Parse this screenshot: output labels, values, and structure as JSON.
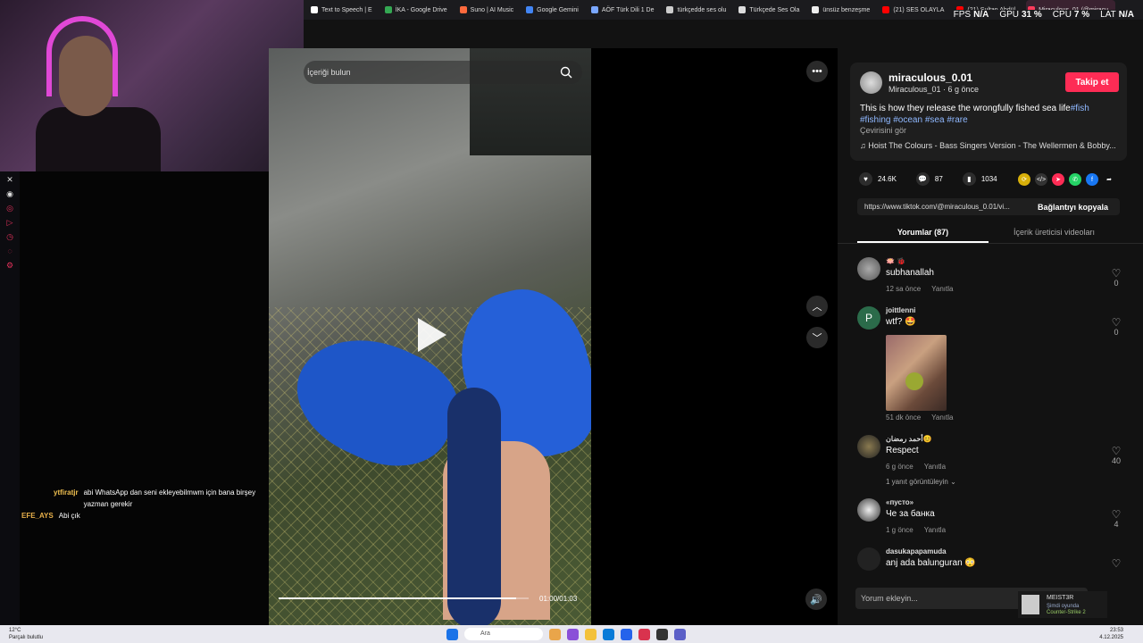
{
  "bookmarks": [
    {
      "label": "Text to Speech | E",
      "color": "#ffffff"
    },
    {
      "label": "İKA - Google Drive",
      "color": "#34a853"
    },
    {
      "label": "Suno | AI Music",
      "color": "#ff6a3d"
    },
    {
      "label": "Google Gemini",
      "color": "#4285f4"
    },
    {
      "label": "AÖF Türk Dili 1 De",
      "color": "#7aa7ff"
    },
    {
      "label": "türkçedde ses olu",
      "color": "#cccccc"
    },
    {
      "label": "Türkçede Ses Ola",
      "color": "#dddddd"
    },
    {
      "label": "ünsüz benzeşme",
      "color": "#eeeeee"
    },
    {
      "label": "(21) SES OLAYLA",
      "color": "#ff0000"
    },
    {
      "label": "(21) Sultan Abdül",
      "color": "#ff0000"
    },
    {
      "label": "Miraculous_01 (@miracu",
      "color": "#ff3b5c"
    }
  ],
  "perf": {
    "fps_label": "FPS",
    "fps": "N/A",
    "gpu_label": "GPU",
    "gpu": "31 %",
    "cpu_label": "CPU",
    "cpu": "7 %",
    "lat_label": "LAT",
    "lat": "N/A"
  },
  "chat": [
    {
      "user": "ytfiratjr",
      "message": "abi WhatsApp dan seni ekleyebilmwm için bana birşey yazman gerekir"
    },
    {
      "user": "EFE_AYS",
      "message": "Abi çık"
    }
  ],
  "video": {
    "search_placeholder": "İçeriği bulun",
    "timecode": "01:00/01:03",
    "progress": 0.95
  },
  "author": {
    "handle": "miraculous_0.01",
    "subline": "Miraculous_01 · 6 g önce",
    "follow_label": "Takip et"
  },
  "description": {
    "text": "This is how they release the wrongfully fished sea life",
    "tags": [
      "#fish",
      "#fishing",
      "#ocean",
      "#sea",
      "#rare"
    ],
    "translate": "Çevirisini gör",
    "music": "Hoist The Colours - Bass Singers Version - The Wellermen & Bobby..."
  },
  "stats": {
    "likes": "24.6K",
    "comments": "87",
    "saves": "1034"
  },
  "link": {
    "url": "https://www.tiktok.com/@miraculous_0.01/vi...",
    "copy_label": "Bağlantıyı kopyala"
  },
  "tabs": {
    "comments": "Yorumlar (87)",
    "creator_videos": "İçerik üreticisi videoları"
  },
  "comments": [
    {
      "name": "🪷 🐞",
      "text": "subhanallah",
      "time": "12 sa önce",
      "reply": "Yanıtla",
      "likes": "0"
    },
    {
      "name": "joittlenni",
      "text": "wtf? 🤩",
      "time": "51 dk önce",
      "reply": "Yanıtla",
      "likes": "0",
      "avatar_letter": "P"
    },
    {
      "name": "أحمد رمضان😊",
      "text": "Respect",
      "time": "6 g önce",
      "reply": "Yanıtla",
      "likes": "40",
      "replies": "1 yanıt görüntüleyin"
    },
    {
      "name": "«пусто»",
      "text": "Че за банка",
      "time": "1 g önce",
      "reply": "Yanıtla",
      "likes": "4"
    },
    {
      "name": "dasukapapamuda",
      "text": "anj ada balunguran 😳",
      "likes": ""
    }
  ],
  "comment_placeholder": "Yorum ekleyin...",
  "notification": {
    "name": "MEIST3R",
    "status": "Şimdi oyunda",
    "game": "Counter-Strike 2"
  },
  "taskbar": {
    "temp": "12°C",
    "weather": "Parçalı bulutlu",
    "search": "Ara",
    "time": "23:53",
    "date": "4.12.2025"
  },
  "colors": {
    "accent": "#fe2c55",
    "tag": "#8fb8ff"
  }
}
